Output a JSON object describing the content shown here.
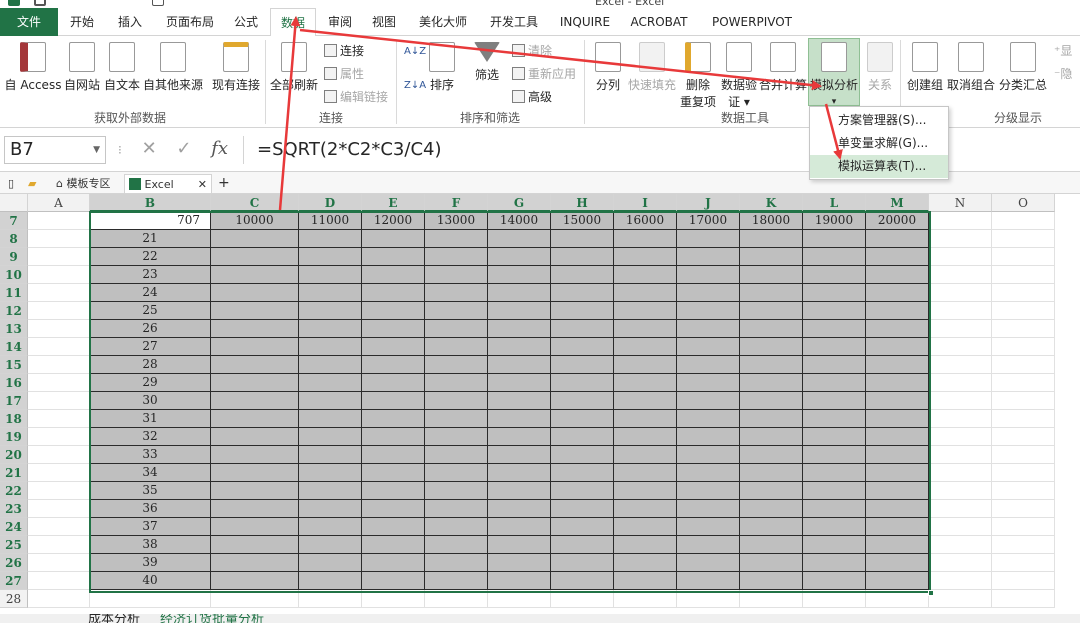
{
  "window": {
    "title": "Excel - Excel"
  },
  "ribbon_tabs": [
    "文件",
    "开始",
    "插入",
    "页面布局",
    "公式",
    "数据",
    "审阅",
    "视图",
    "美化大师",
    "开发工具",
    "INQUIRE",
    "ACROBAT",
    "POWERPIVOT"
  ],
  "active_tab": "数据",
  "ribbon": {
    "external": {
      "access": "自 Access",
      "web": "自网站",
      "text": "自文本",
      "other": "自其他来源",
      "existing": "现有连接",
      "group": "获取外部数据"
    },
    "connections": {
      "refresh": "全部刷新",
      "connect": "连接",
      "props": "属性",
      "edit_links": "编辑链接",
      "group": "连接"
    },
    "sort": {
      "sort": "排序",
      "filter": "筛选",
      "clear": "清除",
      "reapply": "重新应用",
      "advanced": "高级",
      "group": "排序和筛选"
    },
    "datatools": {
      "split": "分列",
      "flash": "快速填充",
      "remove_dup_1": "删除",
      "remove_dup_2": "重复项",
      "validate_1": "数据验",
      "validate_2": "证 ▾",
      "consolidate": "合并计算",
      "whatif": "模拟分析",
      "relations": "关系",
      "group": "数据工具"
    },
    "outline": {
      "group_btn": "创建组",
      "ungroup": "取消组合",
      "subtotal": "分类汇总",
      "show": "显",
      "hide": "隐",
      "group": "分级显示"
    }
  },
  "whatif_menu": [
    "方案管理器(S)...",
    "单变量求解(G)...",
    "模拟运算表(T)..."
  ],
  "formula_bar": {
    "name_box": "B7",
    "fx": "fx",
    "formula": "=SQRT(2*C2*C3/C4)"
  },
  "workbook_tabs": [
    "模板专区",
    "Excel"
  ],
  "sheet": {
    "columns": [
      "A",
      "B",
      "C",
      "D",
      "E",
      "F",
      "G",
      "H",
      "I",
      "J",
      "K",
      "L",
      "M",
      "N",
      "O"
    ],
    "rows": [
      7,
      8,
      9,
      10,
      11,
      12,
      13,
      14,
      15,
      16,
      17,
      18,
      19,
      20,
      21,
      22,
      23,
      24,
      25,
      26,
      27,
      28
    ],
    "b7_value": "707",
    "header_row": [
      "10000",
      "11000",
      "12000",
      "13000",
      "14000",
      "15000",
      "16000",
      "17000",
      "18000",
      "19000",
      "20000"
    ],
    "b_values": [
      "21",
      "22",
      "23",
      "24",
      "25",
      "26",
      "27",
      "28",
      "29",
      "30",
      "31",
      "32",
      "33",
      "34",
      "35",
      "36",
      "37",
      "38",
      "39",
      "40"
    ]
  },
  "sheet_tabs": [
    "成本分析",
    "经济订货批量分析"
  ],
  "colors": {
    "accent": "#217346",
    "arrow": "#e8393a",
    "selection": "#bfbfbf"
  }
}
